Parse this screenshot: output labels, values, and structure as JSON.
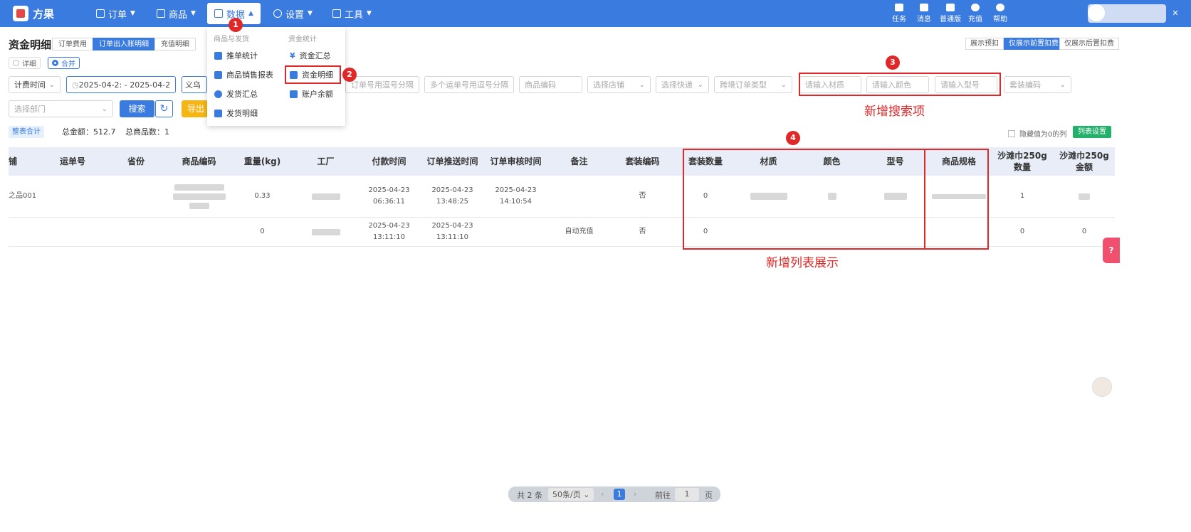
{
  "app": {
    "name": "方果"
  },
  "nav": [
    {
      "label": "订单"
    },
    {
      "label": "商品"
    },
    {
      "label": "数据"
    },
    {
      "label": "设置"
    },
    {
      "label": "工具"
    }
  ],
  "top_icons": [
    "任务",
    "消息",
    "普通版",
    "充值",
    "帮助"
  ],
  "page_title": "资金明细",
  "tabs": [
    "订单费用",
    "订单出入账明细",
    "充值明细"
  ],
  "view_modes": [
    "详细",
    "合并"
  ],
  "display_modes": [
    "展示预扣",
    "仅展示前置扣费",
    "仅展示后置扣费"
  ],
  "filters": {
    "time_type": "计费时间",
    "date_range": "2025-04-2: - 2025-04-2:",
    "city": "义乌",
    "order_nos_ph": "订单号用逗号分隔",
    "waybill_ph": "多个运单号用逗号分隔",
    "product_code_ph": "商品编码",
    "store_ph": "选择店铺",
    "express_ph": "选择快递",
    "cross_order_ph": "跨境订单类型",
    "material_ph": "请输入材质",
    "color_ph": "请输入颜色",
    "model_ph": "请输入型号",
    "set_code_ph": "套装编码",
    "dept_ph": "选择部门"
  },
  "buttons": {
    "search": "搜索",
    "export": "导出",
    "whole_total": "整表合计",
    "col_settings": "列表设置"
  },
  "summary": {
    "total_amount": "总金额：512.7",
    "total_products": "总商品数：1"
  },
  "hide_zero_label": "隐藏值为0的列",
  "dropdown": {
    "group1": "商品与发货",
    "group2": "资金统计",
    "items_left": [
      "推单统计",
      "商品销售报表",
      "发货汇总",
      "发货明细"
    ],
    "items_right": [
      "资金汇总",
      "资金明细",
      "账户余额"
    ]
  },
  "table": {
    "headers": [
      "铺",
      "运单号",
      "省份",
      "商品编码",
      "重量(kg)",
      "工厂",
      "付款时间",
      "订单推送时间",
      "订单审核时间",
      "备注",
      "套装编码",
      "套装数量",
      "材质",
      "颜色",
      "型号",
      "商品规格",
      "沙滩巾250g数量",
      "沙滩巾250g金额"
    ],
    "rows": [
      {
        "store": "之品001",
        "weight": "0.33",
        "pay_time": "2025-04-23 06:36:11",
        "push_time": "2025-04-23 13:48:25",
        "audit_time": "2025-04-23 14:10:54",
        "remark": "",
        "set_code": "否",
        "set_qty": "0",
        "towel_qty": "1",
        "towel_amt": ""
      },
      {
        "store": "",
        "weight": "0",
        "pay_time": "2025-04-23 13:11:10",
        "push_time": "2025-04-23 13:11:10",
        "audit_time": "",
        "remark": "自动充值",
        "set_code": "否",
        "set_qty": "0",
        "towel_qty": "0",
        "towel_amt": "0"
      }
    ]
  },
  "annotations": {
    "m1": "1",
    "m2": "2",
    "m3": "3",
    "m4": "4",
    "new_search": "新增搜索项",
    "new_columns": "新增列表展示"
  },
  "pagination": {
    "total": "共 2 条",
    "per_page": "50条/页",
    "current": "1",
    "goto": "前往",
    "goto_val": "1",
    "page_unit": "页"
  },
  "colors": {
    "primary": "#3a7be0",
    "annotation": "#e02828",
    "export": "#f5b515",
    "colset": "#22b06a"
  }
}
